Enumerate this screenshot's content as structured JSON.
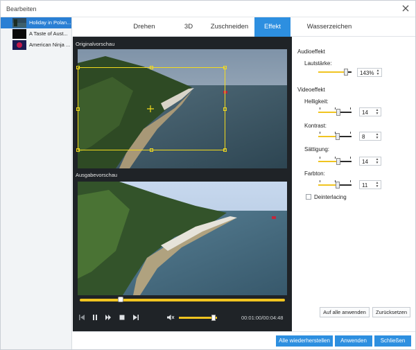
{
  "window": {
    "title": "Bearbeiten"
  },
  "files": [
    {
      "name": "Holiday in Polan...",
      "selected": true
    },
    {
      "name": "A Taste of Aust..."
    },
    {
      "name": "American Ninja ..."
    }
  ],
  "tabs": [
    {
      "label": "Drehen"
    },
    {
      "label": "3D"
    },
    {
      "label": "Zuschneiden"
    },
    {
      "label": "Effekt",
      "active": true
    },
    {
      "label": "Wasserzeichen"
    }
  ],
  "preview": {
    "original_label": "Originalvorschau",
    "output_label": "Ausgabevorschau",
    "seek_fraction": 0.2,
    "volume_fraction": 0.9,
    "time": "00:01:00/00:04:48"
  },
  "audio": {
    "section_title": "Audioeffekt",
    "volume_label": "Lautstärke:",
    "volume_value": "143%"
  },
  "video": {
    "section_title": "Videoeffekt",
    "brightness_label": "Helligkeit:",
    "brightness_value": "14",
    "contrast_label": "Kontrast:",
    "contrast_value": "8",
    "saturation_label": "Sättigung:",
    "saturation_value": "14",
    "hue_label": "Farbton:",
    "hue_value": "11",
    "deinterlacing_label": "Deinterlacing"
  },
  "panel_buttons": {
    "apply_all": "Auf alle anwenden",
    "reset": "Zurücksetzen"
  },
  "footer": {
    "restore_all": "Alle wiederherstellen",
    "apply": "Anwenden",
    "close": "Schließen"
  },
  "colors": {
    "accent": "#2d8fe0",
    "slider_fill": "#f0c420",
    "crop_frame": "#f5dc1d",
    "preview_bg": "#1f2327"
  }
}
